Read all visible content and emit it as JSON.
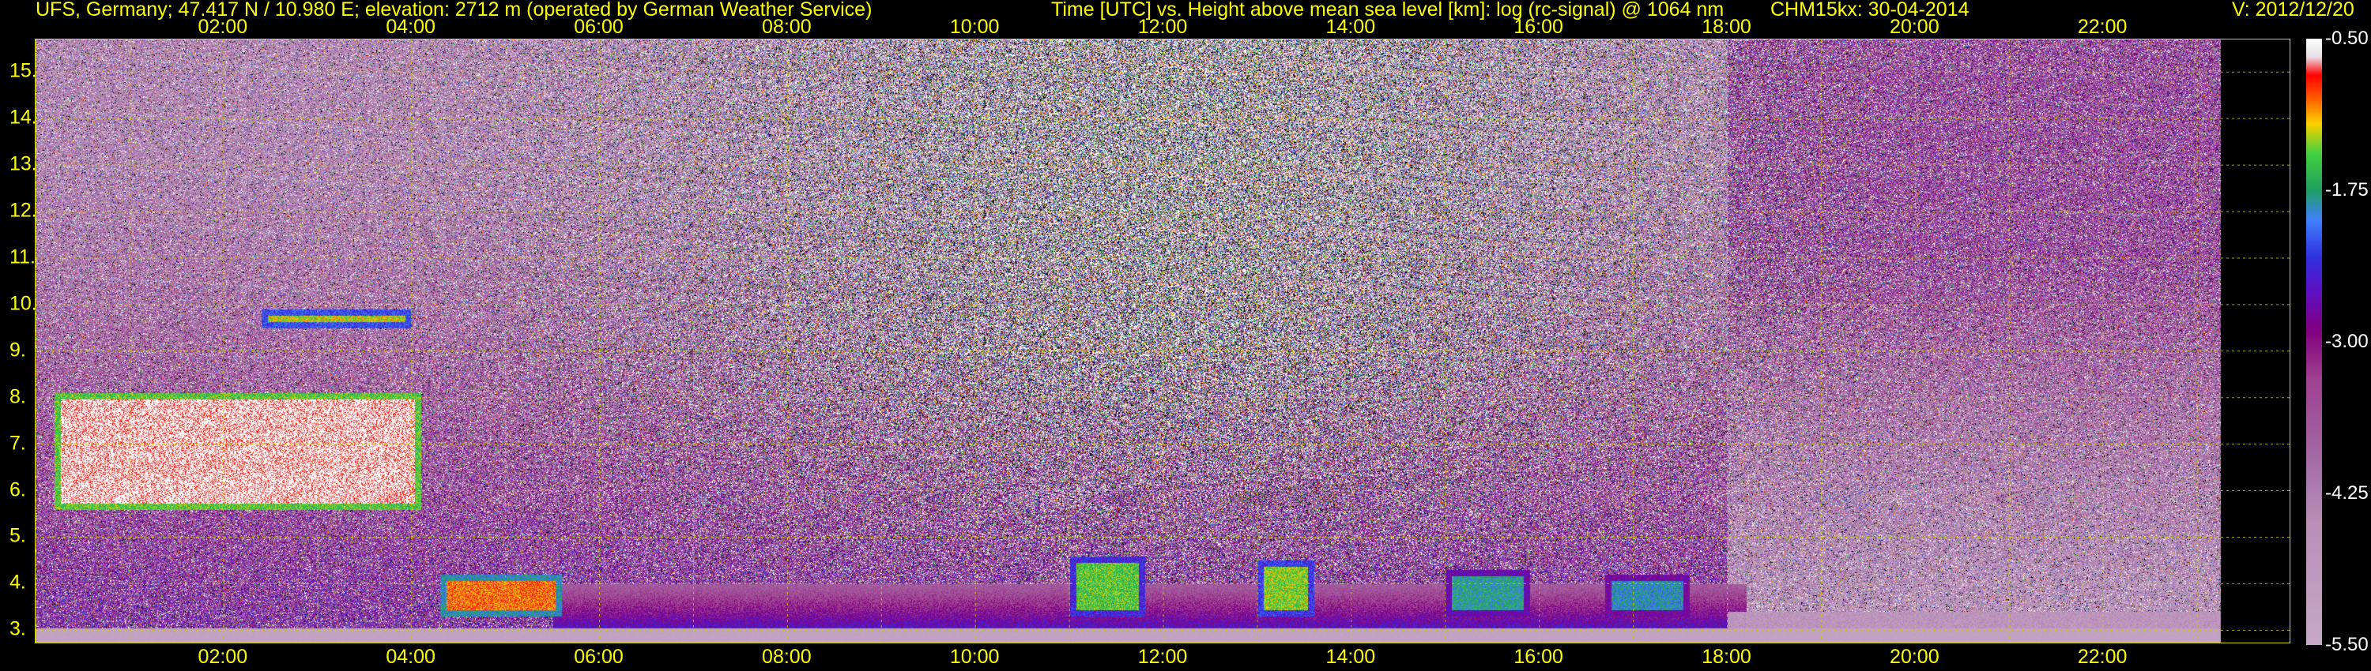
{
  "header": {
    "site": "UFS, Germany; 47.417 N / 10.980 E; elevation: 2712 m  (operated by German Weather Service)",
    "title": "Time [UTC] vs. Height above mean sea level [km]: log (rc-signal) @ 1064 nm",
    "instrument": "CHM15kx: 30-04-2014",
    "version": "V: 2012/12/20"
  },
  "chart_data": {
    "type": "heatmap",
    "title": "Time [UTC] vs. Height above mean sea level [km]: log (rc-signal) @ 1064 nm",
    "xlabel": "Time [UTC]",
    "ylabel": "Height above mean sea level [km]",
    "x_tick_labels": [
      "02:00",
      "04:00",
      "06:00",
      "08:00",
      "10:00",
      "12:00",
      "14:00",
      "16:00",
      "18:00",
      "20:00",
      "22:00"
    ],
    "x_tick_hours": [
      2,
      4,
      6,
      8,
      10,
      12,
      14,
      16,
      18,
      20,
      22
    ],
    "xlim": [
      0,
      24
    ],
    "data_end_hour": 23.25,
    "y_tick_labels": [
      "3.",
      "4.",
      "5.",
      "6.",
      "7.",
      "8.",
      "9.",
      "10.",
      "11.",
      "12.",
      "13.",
      "14.",
      "15."
    ],
    "y_tick_values": [
      3,
      4,
      5,
      6,
      7,
      8,
      9,
      10,
      11,
      12,
      13,
      14,
      15
    ],
    "ylim": [
      2.7,
      15.7
    ],
    "grid": true,
    "grid_color": "#cccc00",
    "colorbar": {
      "tick_labels": [
        "-0.50",
        "-1.75",
        "-3.00",
        "-4.25",
        "-5.50"
      ],
      "tick_values": [
        -0.5,
        -1.75,
        -3.0,
        -4.25,
        -5.5
      ],
      "range": [
        -5.5,
        -0.5
      ]
    },
    "features": [
      {
        "name": "cloud layer",
        "x_start": 0.2,
        "x_end": 4.1,
        "y_bottom": 5.6,
        "y_top": 8.1,
        "level": -0.6
      },
      {
        "name": "thin cloud",
        "x_start": 2.4,
        "x_end": 4.0,
        "y_bottom": 9.5,
        "y_top": 9.9,
        "level": -1.3
      },
      {
        "name": "low cloud",
        "x_start": 4.3,
        "x_end": 5.6,
        "y_bottom": 3.3,
        "y_top": 4.2,
        "level": -1.0
      },
      {
        "name": "convective plume",
        "x_start": 11.0,
        "x_end": 11.8,
        "y_bottom": 3.3,
        "y_top": 4.6,
        "level": -1.5
      },
      {
        "name": "convective plume",
        "x_start": 13.0,
        "x_end": 13.6,
        "y_bottom": 3.3,
        "y_top": 4.5,
        "level": -1.4
      },
      {
        "name": "convective plume",
        "x_start": 15.0,
        "x_end": 15.9,
        "y_bottom": 3.3,
        "y_top": 4.3,
        "level": -1.8
      },
      {
        "name": "convective plume",
        "x_start": 16.7,
        "x_end": 17.6,
        "y_bottom": 3.3,
        "y_top": 4.2,
        "level": -1.9
      }
    ]
  }
}
